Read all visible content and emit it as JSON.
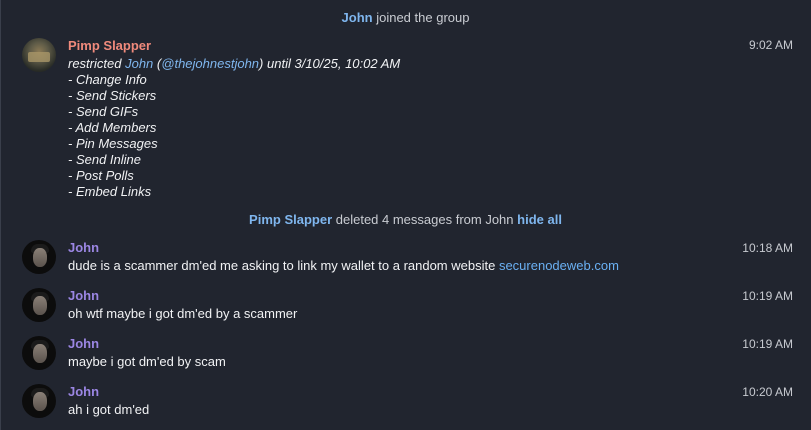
{
  "join_notice": {
    "user": "John",
    "text": "joined the group"
  },
  "admin_message": {
    "sender": "Pimp Slapper",
    "time": "9:02 AM",
    "action": "restricted",
    "target_name": "John",
    "target_open": "(",
    "target_handle": "@thejohnestjohn",
    "target_close": ")",
    "until_text": "until 3/10/25, 10:02 AM",
    "permissions": [
      "- Change Info",
      "- Send Stickers",
      "- Send GIFs",
      "- Add Members",
      "- Pin Messages",
      "- Send Inline",
      "- Post Polls",
      "- Embed Links"
    ]
  },
  "deleted_notice": {
    "admin": "Pimp Slapper",
    "text": "deleted 4 messages from John",
    "action_label": "hide all"
  },
  "messages": [
    {
      "sender": "John",
      "time": "10:18 AM",
      "text": "dude is a scammer dm'ed me asking to link my wallet to a random website ",
      "link": "securenodeweb.com"
    },
    {
      "sender": "John",
      "time": "10:19 AM",
      "text": "oh wtf maybe i got dm'ed by a scammer"
    },
    {
      "sender": "John",
      "time": "10:19 AM",
      "text": "maybe i got dm'ed by scam"
    },
    {
      "sender": "John",
      "time": "10:20 AM",
      "text": "ah i got dm'ed"
    }
  ],
  "colors": {
    "background": "#21252f",
    "link": "#7fb6ee",
    "admin_name": "#f08a7c",
    "john_name": "#9b86e3"
  }
}
